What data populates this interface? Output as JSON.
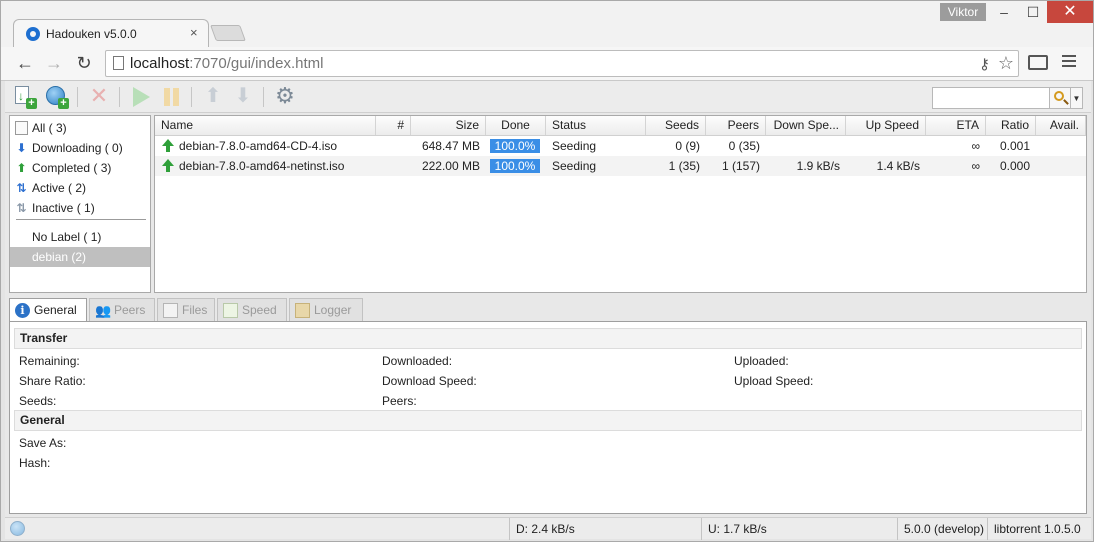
{
  "browser": {
    "tab_title": "Hadouken v5.0.0",
    "tab_close": "×",
    "user": "Viktor",
    "window_controls": {
      "minimize": "–",
      "maximize": "☐",
      "close": "✕"
    },
    "nav": {
      "back": "←",
      "forward": "→",
      "reload": "↻"
    },
    "url_host": "localhost",
    "url_rest": ":7070/gui/index.html",
    "icons": [
      "key-icon",
      "star-icon",
      "cast-icon",
      "menu-icon"
    ]
  },
  "toolbar": {
    "buttons": [
      "add-torrent-file",
      "add-torrent-url",
      "remove",
      "start",
      "pause",
      "move-up",
      "move-down",
      "settings"
    ],
    "remove_glyph": "✕",
    "up_glyph": "⬆",
    "down_glyph": "⬇",
    "settings_glyph": "⚙",
    "search_value": "",
    "search_dropdown": "▼"
  },
  "sidebar": {
    "items": [
      {
        "label": "All ( 3)",
        "icon": "all-icon"
      },
      {
        "label": "Downloading ( 0)",
        "icon": "download-arrow-icon"
      },
      {
        "label": "Completed ( 3)",
        "icon": "completed-arrow-icon"
      },
      {
        "label": "Active ( 2)",
        "icon": "active-arrows-icon"
      },
      {
        "label": "Inactive ( 1)",
        "icon": "inactive-arrows-icon"
      }
    ],
    "labels": [
      {
        "label": "No Label ( 1)"
      },
      {
        "label": "debian (2)",
        "selected": true
      }
    ]
  },
  "table": {
    "columns": [
      "Name",
      "#",
      "Size",
      "Done",
      "Status",
      "Seeds",
      "Peers",
      "Down Spe...",
      "Up Speed",
      "ETA",
      "Ratio",
      "Avail."
    ],
    "rows": [
      {
        "name": "debian-7.8.0-amd64-CD-4.iso",
        "queue": "",
        "size": "648.47 MB",
        "done": "100.0%",
        "done_fraction": 1.0,
        "status": "Seeding",
        "seeds": "0 (9)",
        "peers": "0 (35)",
        "down_speed": "",
        "up_speed": "",
        "eta": "∞",
        "ratio": "0.001",
        "avail": ""
      },
      {
        "name": "debian-7.8.0-amd64-netinst.iso",
        "queue": "",
        "size": "222.00 MB",
        "done": "100.0%",
        "done_fraction": 1.0,
        "status": "Seeding",
        "seeds": "1 (35)",
        "peers": "1 (157)",
        "down_speed": "1.9 kB/s",
        "up_speed": "1.4 kB/s",
        "eta": "∞",
        "ratio": "0.000",
        "avail": ""
      }
    ]
  },
  "detail_tabs": [
    {
      "label": "General",
      "active": true
    },
    {
      "label": "Peers",
      "active": false
    },
    {
      "label": "Files",
      "active": false
    },
    {
      "label": "Speed",
      "active": false
    },
    {
      "label": "Logger",
      "active": false
    }
  ],
  "details": {
    "transfer_title": "Transfer",
    "remaining": "Remaining:",
    "downloaded": "Downloaded:",
    "uploaded": "Uploaded:",
    "share_ratio": "Share Ratio:",
    "download_speed": "Download Speed:",
    "upload_speed": "Upload Speed:",
    "seeds": "Seeds:",
    "peers": "Peers:",
    "general_title": "General",
    "save_as": "Save As:",
    "hash": "Hash:"
  },
  "statusbar": {
    "down": "D: 2.4 kB/s",
    "up": "U: 1.7 kB/s",
    "version": "5.0.0 (develop)",
    "lib": "libtorrent 1.0.5.0"
  },
  "colors": {
    "progress_fill": "#3a8ee6",
    "seeding_arrow": "#2fa03a",
    "close_button": "#c7473d",
    "selected_label": "#bfbfbf"
  }
}
